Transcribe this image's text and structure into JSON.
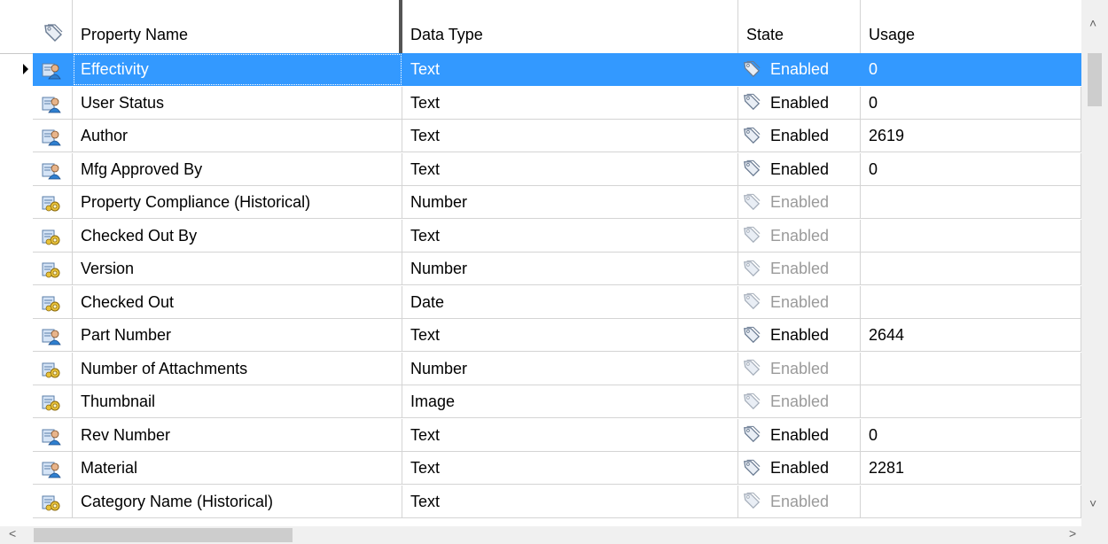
{
  "columns": {
    "name": "Property Name",
    "type": "Data Type",
    "state": "State",
    "usage": "Usage"
  },
  "rows": [
    {
      "name": "Effectivity",
      "type": "Text",
      "state": "Enabled",
      "usage": "0",
      "icon": "user-property-icon",
      "enabled": true,
      "selected": true
    },
    {
      "name": "User Status",
      "type": "Text",
      "state": "Enabled",
      "usage": "0",
      "icon": "user-property-icon",
      "enabled": true
    },
    {
      "name": "Author",
      "type": "Text",
      "state": "Enabled",
      "usage": "2619",
      "icon": "user-property-icon",
      "enabled": true
    },
    {
      "name": "Mfg Approved By",
      "type": "Text",
      "state": "Enabled",
      "usage": "0",
      "icon": "user-property-icon",
      "enabled": true
    },
    {
      "name": "Property Compliance (Historical)",
      "type": "Number",
      "state": "Enabled",
      "usage": "",
      "icon": "system-property-icon",
      "enabled": false
    },
    {
      "name": "Checked Out By",
      "type": "Text",
      "state": "Enabled",
      "usage": "",
      "icon": "system-property-icon",
      "enabled": false
    },
    {
      "name": "Version",
      "type": "Number",
      "state": "Enabled",
      "usage": "",
      "icon": "system-property-icon",
      "enabled": false
    },
    {
      "name": "Checked Out",
      "type": "Date",
      "state": "Enabled",
      "usage": "",
      "icon": "system-property-icon",
      "enabled": false
    },
    {
      "name": "Part Number",
      "type": "Text",
      "state": "Enabled",
      "usage": "2644",
      "icon": "user-property-icon",
      "enabled": true
    },
    {
      "name": "Number of Attachments",
      "type": "Number",
      "state": "Enabled",
      "usage": "",
      "icon": "system-property-icon",
      "enabled": false
    },
    {
      "name": "Thumbnail",
      "type": "Image",
      "state": "Enabled",
      "usage": "",
      "icon": "system-property-icon",
      "enabled": false
    },
    {
      "name": "Rev Number",
      "type": "Text",
      "state": "Enabled",
      "usage": "0",
      "icon": "user-property-icon",
      "enabled": true
    },
    {
      "name": "Material",
      "type": "Text",
      "state": "Enabled",
      "usage": "2281",
      "icon": "user-property-icon",
      "enabled": true
    },
    {
      "name": "Category Name (Historical)",
      "type": "Text",
      "state": "Enabled",
      "usage": "",
      "icon": "system-property-icon",
      "enabled": false
    }
  ],
  "colors": {
    "selection": "#3399ff",
    "disabled_text": "#9a9a9a",
    "grid_line": "#d4d4d4"
  }
}
